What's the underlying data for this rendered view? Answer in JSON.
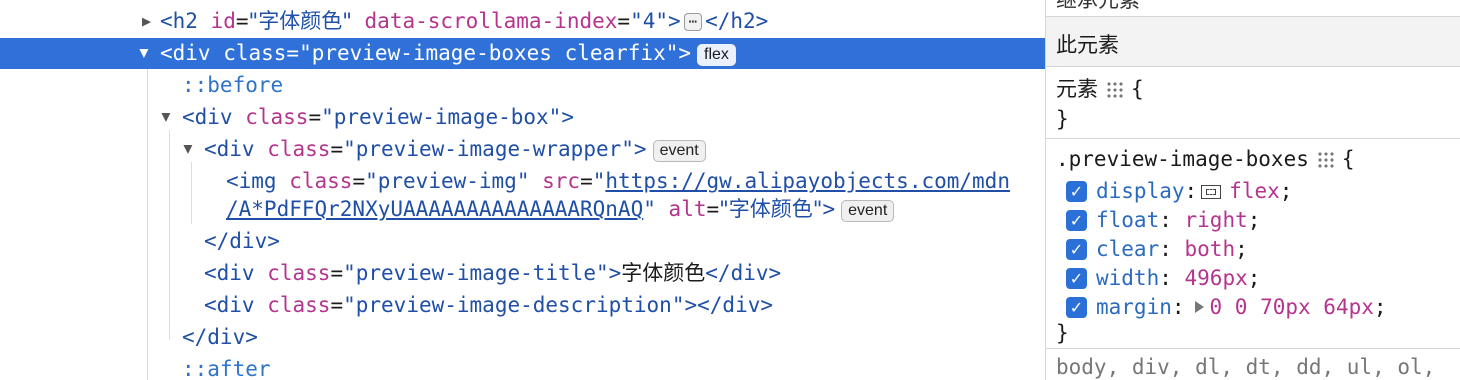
{
  "tree": {
    "row0": {
      "tag_open": "<h2",
      "attr1": "id",
      "val1": "\"字体颜色\"",
      "attr2": "data-scrollama-index",
      "val2": "\"4\"",
      "ellipsis": "⋯",
      "close": "</h2>"
    },
    "row1": {
      "text": "<div class=\"preview-image-boxes clearfix\">",
      "badge": "flex"
    },
    "row2": {
      "text": "::before"
    },
    "row3": {
      "tag": "<div",
      "attr": "class",
      "val": "\"preview-image-box\""
    },
    "row4": {
      "tag": "<div",
      "attr": "class",
      "val": "\"preview-image-wrapper\"",
      "badge": "event"
    },
    "row5": {
      "tag": "<img",
      "attr1": "class",
      "val1": "\"preview-img\"",
      "attr2": "src",
      "link1": "https://gw.alipayobjects.com/mdn"
    },
    "row6": {
      "link2": "/A*PdFFQr2NXyUAAAAAAAAAAAAAARQnAQ",
      "attr3": "alt",
      "val3": "\"字体颜色\"",
      "badge": "event"
    },
    "row7": {
      "text": "</div>"
    },
    "row8": {
      "tag": "<div",
      "attr": "class",
      "val": "\"preview-image-title\"",
      "content": "字体颜色",
      "close": "</div>"
    },
    "row9": {
      "tag": "<div",
      "attr": "class",
      "val": "\"preview-image-description\"",
      "close": "</div>"
    },
    "row10": {
      "text": "</div>"
    },
    "row11": {
      "text": "::after"
    }
  },
  "styles": {
    "top_cut": "继承元素",
    "this_element": "此元素",
    "element_label": "元素",
    "open_brace": "{",
    "close_brace": "}",
    "rule_selector": ".preview-image-boxes",
    "props": [
      {
        "name": "display",
        "value": "flex",
        "checked": true
      },
      {
        "name": "float",
        "value": "right",
        "checked": true
      },
      {
        "name": "clear",
        "value": "both",
        "checked": true
      },
      {
        "name": "width",
        "value": "496px",
        "checked": true
      },
      {
        "name": "margin",
        "value": "0 0 70px 64px",
        "checked": true
      }
    ],
    "next_rule": "body, div, dl, dt, dd, ul, ol,"
  },
  "colors": {
    "selection": "#2f71d8",
    "tag": "#1f4fa6",
    "attr": "#b5348d",
    "checkbox": "#2b70d6"
  }
}
